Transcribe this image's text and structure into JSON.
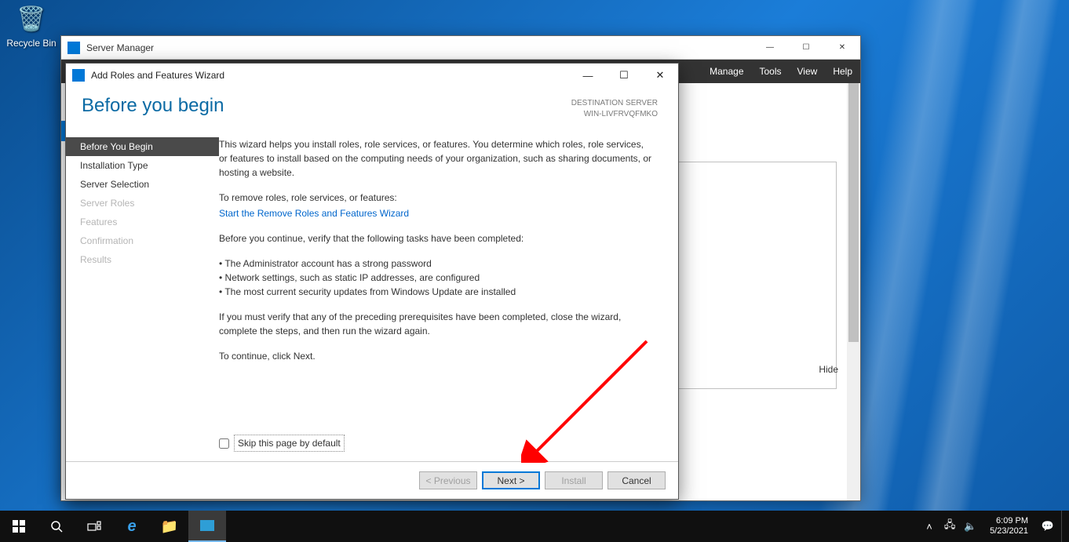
{
  "desktop": {
    "recycle_bin": "Recycle Bin"
  },
  "server_manager": {
    "title": "Server Manager",
    "menu": {
      "manage": "Manage",
      "tools": "Tools",
      "view": "View",
      "help": "Help"
    },
    "hide": "Hide"
  },
  "wizard": {
    "title": "Add Roles and Features Wizard",
    "heading": "Before you begin",
    "dest_label": "DESTINATION SERVER",
    "dest_server": "WIN-LIVFRVQFMKO",
    "nav": {
      "before": "Before You Begin",
      "install_type": "Installation Type",
      "server_sel": "Server Selection",
      "server_roles": "Server Roles",
      "features": "Features",
      "confirmation": "Confirmation",
      "results": "Results"
    },
    "content": {
      "p1": "This wizard helps you install roles, role services, or features. You determine which roles, role services, or features to install based on the computing needs of your organization, such as sharing documents, or hosting a website.",
      "p2": "To remove roles, role services, or features:",
      "link": "Start the Remove Roles and Features Wizard",
      "p3": "Before you continue, verify that the following tasks have been completed:",
      "b1": "The Administrator account has a strong password",
      "b2": "Network settings, such as static IP addresses, are configured",
      "b3": "The most current security updates from Windows Update are installed",
      "p4": "If you must verify that any of the preceding prerequisites have been completed, close the wizard, complete the steps, and then run the wizard again.",
      "p5": "To continue, click Next."
    },
    "skip_label": "Skip this page by default",
    "buttons": {
      "previous": "< Previous",
      "next": "Next >",
      "install": "Install",
      "cancel": "Cancel"
    }
  },
  "taskbar": {
    "time": "6:09 PM",
    "date": "5/23/2021"
  }
}
